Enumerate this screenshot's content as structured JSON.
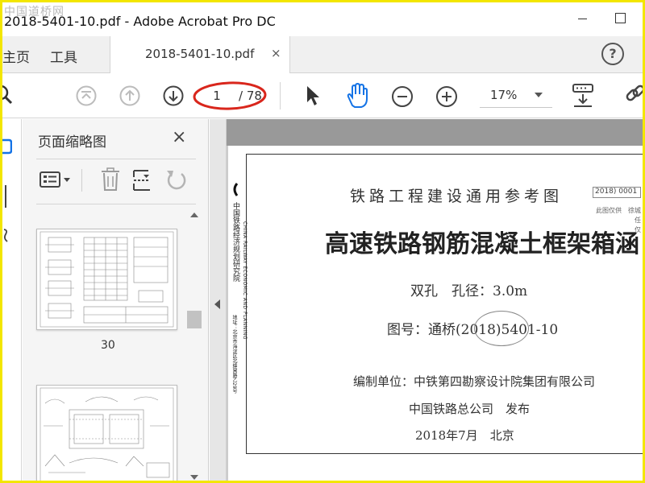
{
  "window": {
    "watermark": "中国道桥网",
    "title": "2018-5401-10.pdf - Adobe Acrobat Pro DC"
  },
  "tabs": {
    "home": "主页",
    "tools": "工具",
    "doc": "2018-5401-10.pdf",
    "close": "×",
    "help": "?"
  },
  "toolbar": {
    "page_current": "1",
    "page_total": "/ 78",
    "zoom": "17%",
    "annotation_color": "#d9261c"
  },
  "thumbnails": {
    "title": "页面缩略图",
    "close": "×",
    "page_label": "30"
  },
  "document": {
    "heading": "铁路工程建设通用参考图",
    "main_title": "高速铁路钢筋混凝土框架箱涵",
    "subtitle": "双孔　孔径：3.0m",
    "drawing_no": "图号：通桥(2018)5401-10",
    "compiler": "编制单位：中铁第四勘察设计院集团有限公司",
    "publisher": "中国铁路总公司　发布",
    "date": "2018年7月　北京",
    "side_org": "中国铁路经济规划研究院",
    "side_org_en": "CHINA RAILWAY ECONOMIC AND PLANNING",
    "side_address": "地址：北京市海淀区北蜂窝路乙29号",
    "stamp": "2018) 0001",
    "note_line1": "此图仅供　徐城",
    "note_line2": "　　　　　　任",
    "note_line3": "　　　　　　仅"
  }
}
